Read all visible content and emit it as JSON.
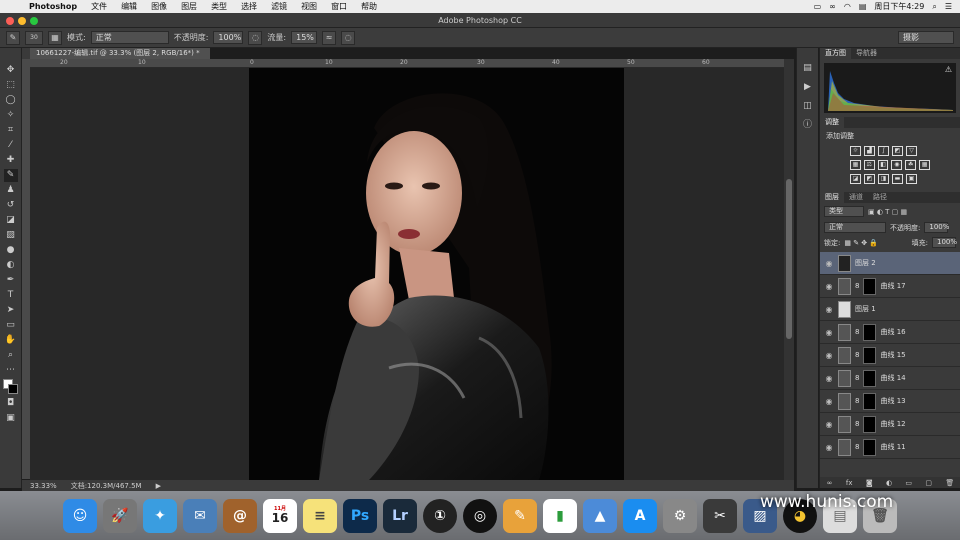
{
  "menubar": {
    "app_name": "Photoshop",
    "items": [
      "文件",
      "编辑",
      "图像",
      "图层",
      "类型",
      "选择",
      "滤镜",
      "视图",
      "窗口",
      "帮助"
    ],
    "clock": "周日下午4:29"
  },
  "window": {
    "title": "Adobe Photoshop CC"
  },
  "options": {
    "brush_size": "30",
    "mode_label": "模式:",
    "mode_value": "正常",
    "opacity_label": "不透明度:",
    "opacity_value": "100%",
    "flow_label": "流量:",
    "flow_value": "15%",
    "workspace": "摄影"
  },
  "document": {
    "tab_label": "10661227-编辑.tif @ 33.3% (图层 2, RGB/16*) *",
    "ruler_ticks": [
      "20",
      "10",
      "0",
      "10",
      "20",
      "30",
      "40",
      "50",
      "60"
    ]
  },
  "status": {
    "zoom": "33.33%",
    "doc_size": "文档:120.3M/467.5M"
  },
  "panels": {
    "histogram_tabs": [
      "直方图",
      "导航器"
    ],
    "adjust_tab": "调整",
    "adjust_title": "添加调整",
    "layers_tabs": [
      "图层",
      "通道",
      "路径"
    ],
    "filter_kind": "类型",
    "blend_mode": "正常",
    "opacity_label": "不透明度:",
    "opacity_value": "100%",
    "lock_label": "锁定:",
    "fill_label": "填充:",
    "fill_value": "100%",
    "layers": [
      {
        "name": "图层 2"
      },
      {
        "name": "曲线 17"
      },
      {
        "name": "图层 1"
      },
      {
        "name": "曲线 16"
      },
      {
        "name": "曲线 15"
      },
      {
        "name": "曲线 14"
      },
      {
        "name": "曲线 13"
      },
      {
        "name": "曲线 12"
      },
      {
        "name": "曲线 11"
      }
    ]
  },
  "dock": {
    "calendar_month": "11月",
    "calendar_day": "16",
    "ps_label": "Ps",
    "lr_label": "Lr"
  },
  "watermark": "www.hunis.com",
  "colors": {
    "panel_bg": "#3a3a3a",
    "selected_layer": "#5a6478",
    "accent": "#2d6fd1"
  }
}
